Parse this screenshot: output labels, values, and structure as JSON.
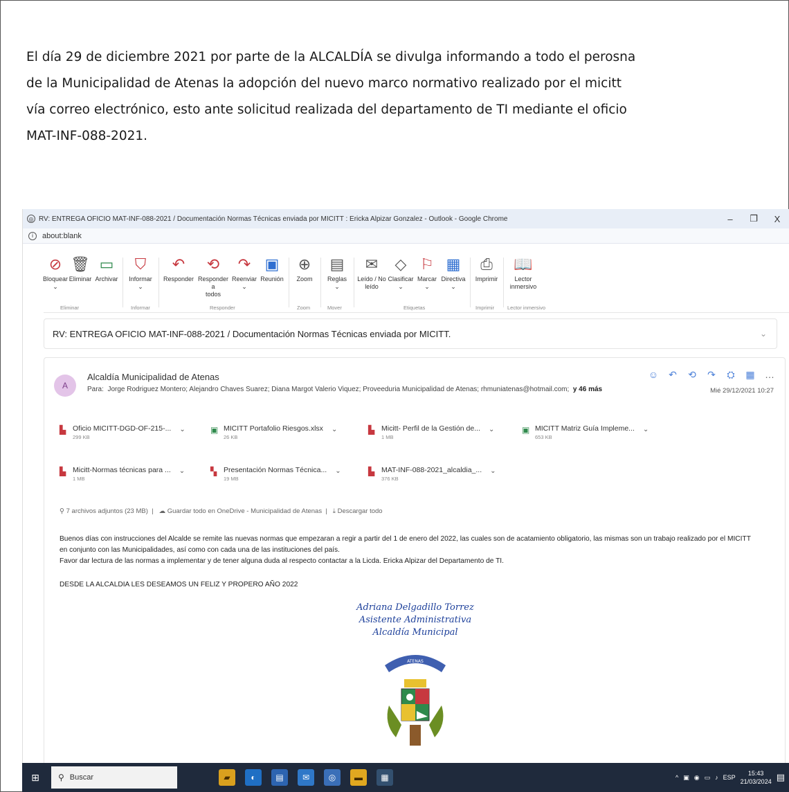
{
  "intro": {
    "lines": [
      "El día 29 de diciembre 2021 por parte de la ALCALDÍA se divulga informando a todo el perosna",
      "de la Municipalidad de Atenas la adopción del nuevo marco normativo realizado por el micitt",
      "vía correo electrónico, esto ante solicitud realizada del departamento de TI mediante el oficio",
      "MAT-INF-088-2021."
    ]
  },
  "window": {
    "title": "RV: ENTREGA OFICIO MAT-INF-088-2021 / Documentación Normas Técnicas enviada por MICITT : Ericka Alpizar Gonzalez - Outlook - Google Chrome",
    "address": "about:blank",
    "minimize": "–",
    "maximize": "❐",
    "close": "X"
  },
  "ribbon": {
    "buttons": [
      {
        "label": "Bloquear",
        "sub": "⌄",
        "icon": "block-icon"
      },
      {
        "label": "Eliminar",
        "sub": "",
        "icon": "trash-icon"
      },
      {
        "label": "Archivar",
        "sub": "",
        "icon": "archive-icon"
      },
      {
        "label": "Informar",
        "sub": "⌄",
        "icon": "report-icon"
      },
      {
        "label": "Responder",
        "sub": "",
        "icon": "reply-icon"
      },
      {
        "label": "Responder a",
        "sub": "todos",
        "icon": "reply-all-icon"
      },
      {
        "label": "Reenviar",
        "sub": "⌄",
        "icon": "forward-icon"
      },
      {
        "label": "Reunión",
        "sub": "",
        "icon": "meeting-icon"
      },
      {
        "label": "Zoom",
        "sub": "",
        "icon": "zoom-icon"
      },
      {
        "label": "Reglas",
        "sub": "⌄",
        "icon": "rules-icon"
      },
      {
        "label": "Leído / No",
        "sub": "leído",
        "icon": "read-icon"
      },
      {
        "label": "Clasificar",
        "sub": "⌄",
        "icon": "tag-icon"
      },
      {
        "label": "Marcar",
        "sub": "⌄",
        "icon": "flag-icon"
      },
      {
        "label": "Directiva",
        "sub": "⌄",
        "icon": "policy-icon"
      },
      {
        "label": "Imprimir",
        "sub": "",
        "icon": "print-icon"
      },
      {
        "label": "Lector",
        "sub": "inmersivo",
        "icon": "immersive-reader-icon"
      }
    ],
    "groups": [
      "Eliminar",
      "Informar",
      "Responder",
      "Zoom",
      "Mover",
      "Etiquetas",
      "Imprimir",
      "Lector inmersivo"
    ]
  },
  "subject": "RV: ENTREGA OFICIO MAT-INF-088-2021 /  Documentación  Normas Técnicas enviada por MICITT.",
  "message": {
    "avatar": "A",
    "sender": "Alcaldía Municipalidad de Atenas",
    "to_prefix": "Para:",
    "to": "Jorge Rodriguez Montero;  Alejandro Chaves Suarez;  Diana Margot Valerio Viquez;  Proveeduria Municipalidad de Atenas;  rhmuniatenas@hotmail.com;",
    "to_more": "y 46 más",
    "date": "Mié 29/12/2021 10:27",
    "attachments": [
      {
        "name": "Oficio MICITT-DGD-OF-215-...",
        "size": "299 KB",
        "type": "pdf"
      },
      {
        "name": "MICITT Portafolio Riesgos.xlsx",
        "size": "26 KB",
        "type": "xlsx"
      },
      {
        "name": "Micitt- Perfil de la Gestión de...",
        "size": "1 MB",
        "type": "pdf"
      },
      {
        "name": "MICITT Matriz Guía Impleme...",
        "size": "653 KB",
        "type": "xlsx"
      },
      {
        "name": "Micitt-Normas técnicas para ...",
        "size": "1 MB",
        "type": "pdf"
      },
      {
        "name": "Presentación Normas Técnica...",
        "size": "19 MB",
        "type": "pptx"
      },
      {
        "name": "MAT-INF-088-2021_alcaldia_...",
        "size": "376 KB",
        "type": "pdf"
      }
    ],
    "attach_count": "7 archivos adjuntos (23 MB)",
    "save_onedrive": "Guardar todo en OneDrive - Municipalidad de Atenas",
    "download_all": "Descargar todo",
    "body": [
      "Buenos días con instrucciones del Alcalde se remite las nuevas normas que empezaran a regir a partir del 1 de enero del 2022, las cuales son de acatamiento obligatorio, las mismas son un trabajo realizado por el MICITT",
      "en conjunto con las Municipalidades, así como con cada una de las instituciones del país.",
      "Favor dar lectura de las normas a implementar y de tener alguna duda al respecto contactar a la Licda. Ericka Alpizar del Departamento de TI."
    ],
    "closing": "DESDE LA ALCALDIA LES DESEAMOS UN FELIZ Y PROPERO AÑO 2022",
    "signature": [
      "Adriana Delgadillo Torrez",
      "Asistente Administrativa",
      "Alcaldía Municipal"
    ],
    "crest_banner": "ATENAS"
  },
  "taskbar": {
    "search_placeholder": "Buscar",
    "lang": "ESP",
    "time": "15:43",
    "date": "21/03/2024"
  }
}
